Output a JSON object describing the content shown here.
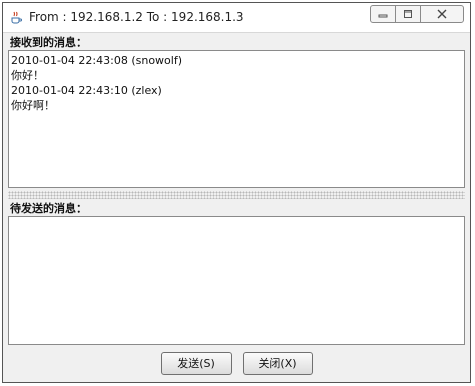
{
  "window": {
    "title": "From : 192.168.1.2 To : 192.168.1.3",
    "icon": "java-coffee-icon",
    "controls": {
      "minimize": "minimize-icon",
      "maximize": "maximize-icon",
      "close": "close-icon"
    }
  },
  "received": {
    "label": "接收到的消息：",
    "messages": [
      {
        "header": "2010-01-04 22:43:08 (snowolf)",
        "text": "你好！"
      },
      {
        "header": "2010-01-04 22:43:10 (zlex)",
        "text": "你好啊！"
      }
    ]
  },
  "compose": {
    "label": "待发送的消息：",
    "value": ""
  },
  "buttons": {
    "send_label": "发送(S)",
    "close_label": "关闭(X)"
  }
}
